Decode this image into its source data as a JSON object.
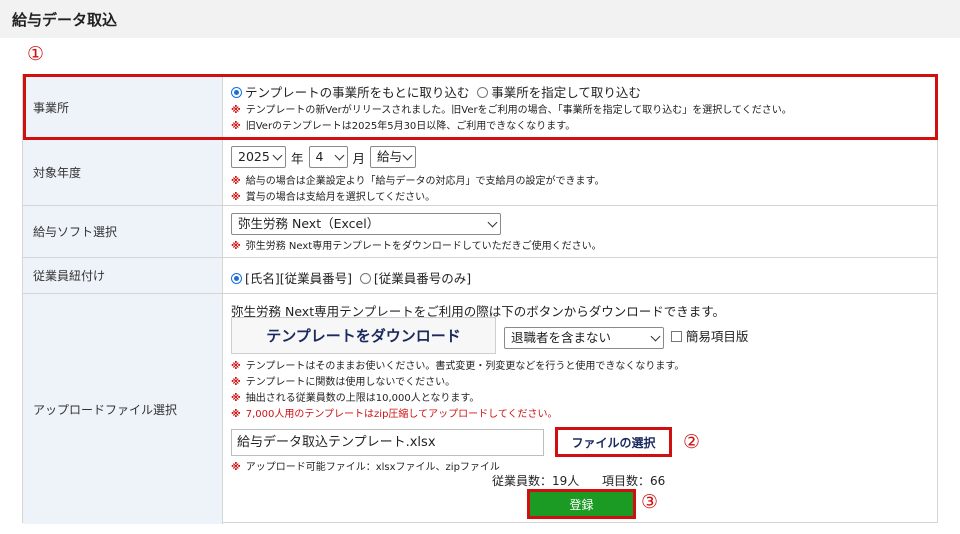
{
  "page": {
    "title": "給与データ取込"
  },
  "annotations": {
    "one": "①",
    "two": "②",
    "three": "③"
  },
  "note_mark": "※",
  "rows": {
    "office": {
      "label": "事業所",
      "options": [
        "テンプレートの事業所をもとに取り込む",
        "事業所を指定して取り込む"
      ],
      "selected_index": 0,
      "notes": [
        "テンプレートの新Verがリリースされました。旧Verをご利用の場合、「事業所を指定して取り込む」を選択してください。",
        "旧Verのテンプレートは2025年5月30日以降、ご利用できなくなります。"
      ]
    },
    "period": {
      "label": "対象年度",
      "year": "2025",
      "year_unit": "年",
      "month": "4",
      "month_unit": "月",
      "kind": "給与",
      "notes": [
        "給与の場合は企業設定より「給与データの対応月」で支給月の設定ができます。",
        "賞与の場合は支給月を選択してください。"
      ]
    },
    "software": {
      "label": "給与ソフト選択",
      "selected": "弥生労務 Next（Excel）",
      "notes": [
        "弥生労務 Next専用テンプレートをダウンロードしていただきご使用ください。"
      ]
    },
    "employee_link": {
      "label": "従業員紐付け",
      "options": [
        "[氏名][従業員番号]",
        "[従業員番号のみ]"
      ],
      "selected_index": 0
    },
    "upload": {
      "label": "アップロードファイル選択",
      "intro": "弥生労務 Next専用テンプレートをご利用の際は下のボタンからダウンロードできます。",
      "download_button": "テンプレートをダウンロード",
      "retired_select": "退職者を含まない",
      "simple_checkbox": "簡易項目版",
      "notes": [
        "テンプレートはそのままお使いください。書式変更・列変更などを行うと使用できなくなります。",
        "テンプレートに関数は使用しないでください。",
        "抽出される従業員数の上限は10,000人となります。"
      ],
      "notes_red": [
        "7,000人用のテンプレートはzip圧縮してアップロードしてください。"
      ],
      "file_name": "給与データ取込テンプレート.xlsx",
      "file_button": "ファイルの選択",
      "file_note": "アップロード可能ファイル：xlsxファイル、zipファイル",
      "employee_count": "従業員数：19人",
      "item_count": "項目数：66",
      "register_button": "登録"
    }
  },
  "colors": {
    "highlight": "#d01010",
    "label_bg": "#eef3f9",
    "register_bg": "#1b9a24",
    "button_text": "#1b2a5e"
  }
}
